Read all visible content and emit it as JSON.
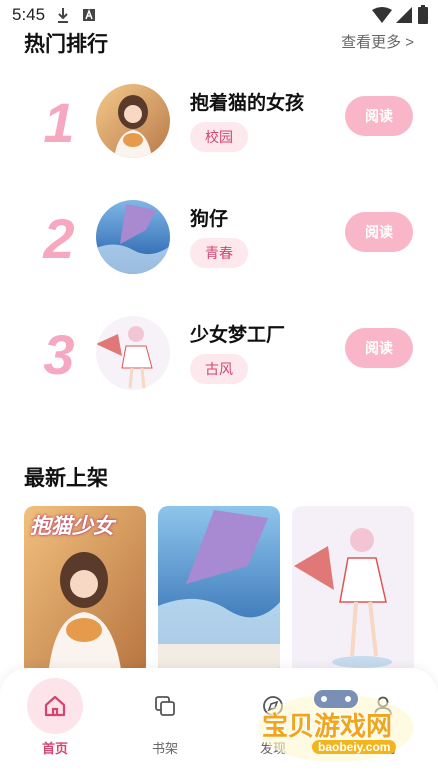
{
  "status_bar": {
    "time": "5:45"
  },
  "hot": {
    "title": "热门排行",
    "more": "查看更多 >",
    "items": [
      {
        "rank": "1",
        "title": "抱着猫的女孩",
        "tag": "校园",
        "button": "阅读"
      },
      {
        "rank": "2",
        "title": "狗仔",
        "tag": "青春",
        "button": "阅读"
      },
      {
        "rank": "3",
        "title": "少女梦工厂",
        "tag": "古风",
        "button": "阅读"
      }
    ]
  },
  "latest": {
    "title": "最新上架",
    "cards": [
      {
        "cover_text": "抱猫少女"
      },
      {
        "cover_text": ""
      },
      {
        "cover_text": ""
      }
    ]
  },
  "tabbar": {
    "tabs": [
      {
        "label": "首页",
        "icon": "home-icon",
        "active": true
      },
      {
        "label": "书架",
        "icon": "bookshelf-icon",
        "active": false
      },
      {
        "label": "发现",
        "icon": "discover-icon",
        "active": false
      },
      {
        "label": "我的",
        "icon": "profile-icon",
        "active": false
      }
    ]
  },
  "watermark": {
    "text": "宝贝游戏网",
    "url": "baobeiy.com"
  },
  "colors": {
    "accent": "#d6456f",
    "rank": "#f5a8bf",
    "button": "#f9b6c8",
    "tag_bg": "#fde8ee"
  }
}
